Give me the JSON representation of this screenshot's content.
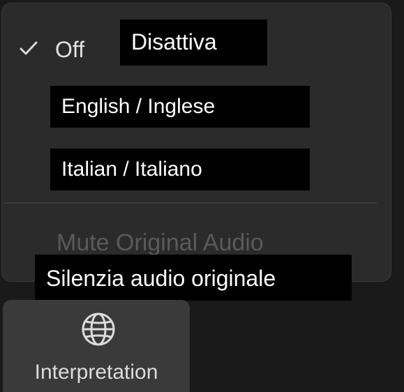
{
  "menu": {
    "items": [
      {
        "label": "Off",
        "checked": true,
        "translation": "Disattiva"
      },
      {
        "label": "",
        "translation": "English / Inglese"
      },
      {
        "label": "",
        "translation": "Italian / Italiano"
      }
    ],
    "mute": {
      "label": "Mute Original Audio",
      "translation": "Silenzia audio originale",
      "disabled": true
    }
  },
  "toolbar": {
    "interpretation": {
      "label": "Interpretation",
      "icon": "globe-icon"
    }
  },
  "colors": {
    "panel_bg": "#2b2b2b",
    "overlay_bg": "#000000",
    "disabled_text": "#5a5a5a",
    "button_bg": "#3a3a3a"
  }
}
